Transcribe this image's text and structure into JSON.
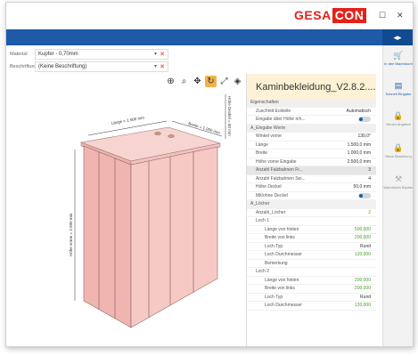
{
  "logo": {
    "left": "GESA",
    "right": "CON"
  },
  "window_controls": {
    "minimize": "–",
    "maximize": "☐",
    "close": "✕"
  },
  "collapse_label": "◂▸",
  "material": {
    "label": "Material",
    "value": "Kupfer - 0,70mm"
  },
  "beschriftung": {
    "label": "Beschriftung",
    "value": "(Keine Beschriftung)"
  },
  "panel": {
    "title": "Kaminbekleidung_V2.8.2....",
    "sections": [
      {
        "type": "sec",
        "k": "Eigenschaften"
      },
      {
        "type": "row",
        "k": "Zuschnitt Eckteile",
        "v": "Automatisch"
      },
      {
        "type": "toggle",
        "k": "Eingabe über Höhe n/n..."
      },
      {
        "type": "sec",
        "k": "A_Eingabe Werte"
      },
      {
        "type": "row",
        "k": "Winkel vorne",
        "v": "130,0°"
      },
      {
        "type": "row",
        "k": "Länge",
        "v": "1.500,0 mm"
      },
      {
        "type": "row",
        "k": "Breite",
        "v": "1.000,0 mm"
      },
      {
        "type": "row",
        "k": "Höhe vorne Eingabe",
        "v": "2.500,0 mm"
      },
      {
        "type": "hl",
        "k": "Anzahl Falzbahnen Fr...",
        "v": "3"
      },
      {
        "type": "row",
        "k": "Anzahl Falzbahnen Sei...",
        "v": "4"
      },
      {
        "type": "row",
        "k": "Höhe Deckel",
        "v": "50,0 mm"
      },
      {
        "type": "toggle",
        "k": "Mit/ohne Deckel"
      },
      {
        "type": "sec",
        "k": "A_Löcher"
      },
      {
        "type": "row",
        "k": "Anzahl_Löcher",
        "v": "2",
        "g": true
      },
      {
        "type": "row",
        "k": "Loch 1",
        "v": ""
      },
      {
        "type": "sub",
        "k": "Länge von hinten",
        "v": "500,000",
        "g": true
      },
      {
        "type": "sub",
        "k": "Breite von links",
        "v": "200,000",
        "g": true
      },
      {
        "type": "sub",
        "k": "Loch Typ",
        "v": "Rund"
      },
      {
        "type": "sub",
        "k": "Loch Durchmesser",
        "v": "120,000",
        "g": true
      },
      {
        "type": "sub",
        "k": "Bemerkung",
        "v": ""
      },
      {
        "type": "row",
        "k": "Loch 2",
        "v": ""
      },
      {
        "type": "sub",
        "k": "Länge von hinten",
        "v": "200,000",
        "g": true
      },
      {
        "type": "sub",
        "k": "Breite von links",
        "v": "200,000",
        "g": true
      },
      {
        "type": "sub",
        "k": "Loch Typ",
        "v": "Rund"
      },
      {
        "type": "sub",
        "k": "Loch Durchmesser",
        "v": "120,000",
        "g": true
      }
    ]
  },
  "sidebar": [
    {
      "label": "In den Warenkorb",
      "icon": "🛒",
      "active": true
    },
    {
      "label": "Schnell Eingabe",
      "icon": "▤",
      "active": true
    },
    {
      "label": "Neues Angebot",
      "icon": "🔒",
      "active": false
    },
    {
      "label": "Neue Bestellung",
      "icon": "🔒",
      "active": false
    },
    {
      "label": "Warenkorb Bacher",
      "icon": "⚒",
      "active": false
    }
  ],
  "dims": {
    "laenge": "Länge = 1.500 mm",
    "breite": "Breite = 1.000 mm",
    "hoehe_vorne": "Höhe vorne = 2.500 mm",
    "hoehe_deckel": "Höhe Deckel = 50 mm"
  }
}
